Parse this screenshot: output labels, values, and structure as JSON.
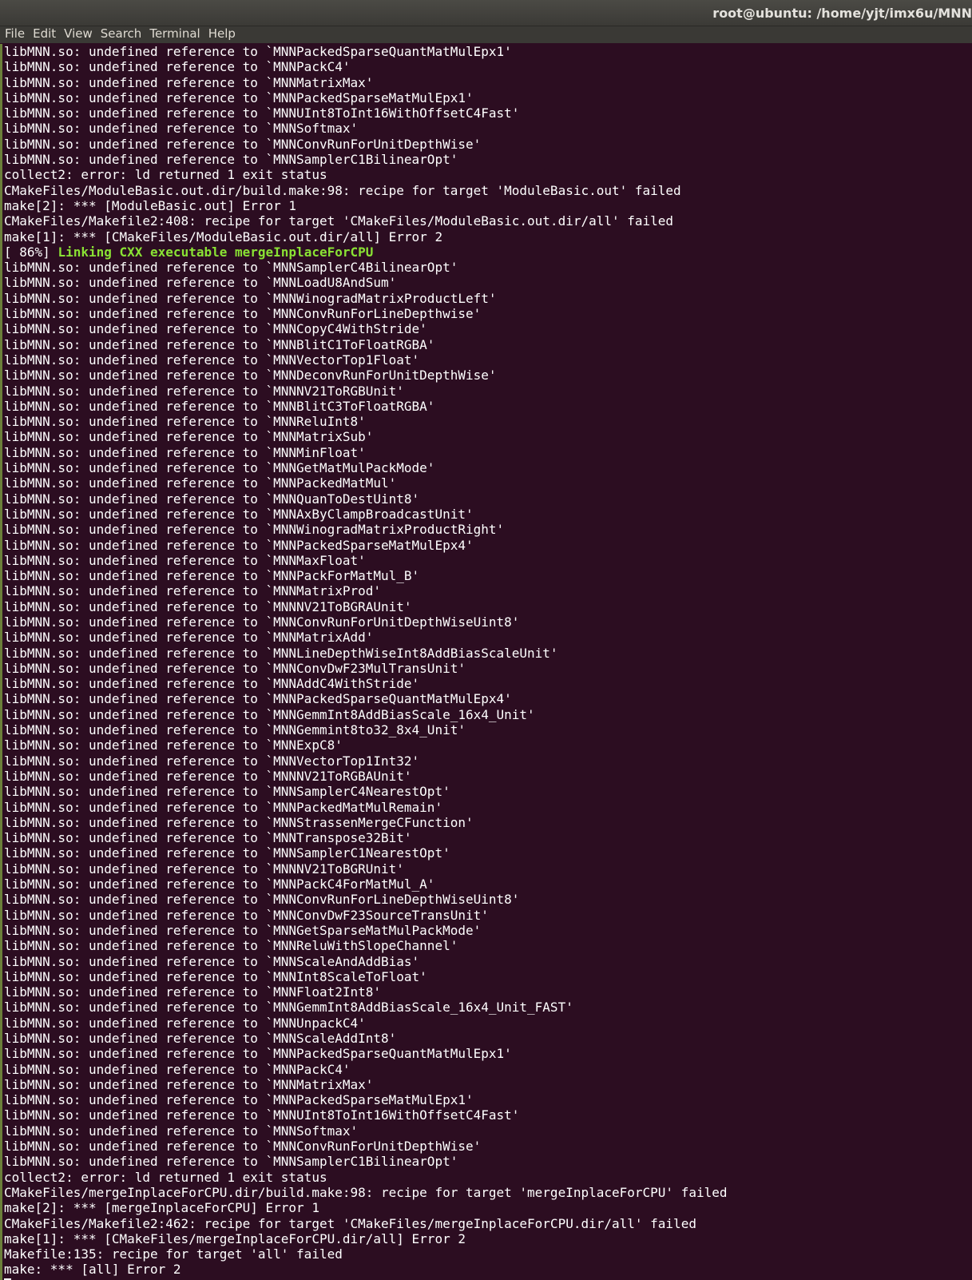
{
  "window": {
    "title": "root@ubuntu: /home/yjt/imx6u/MNN",
    "menu": [
      "File",
      "Edit",
      "View",
      "Search",
      "Terminal",
      "Help"
    ]
  },
  "terminal": {
    "lines": [
      {
        "text": "libMNN.so: undefined reference to `MNNPackedSparseQuantMatMulEpx1'"
      },
      {
        "text": "libMNN.so: undefined reference to `MNNPackC4'"
      },
      {
        "text": "libMNN.so: undefined reference to `MNNMatrixMax'"
      },
      {
        "text": "libMNN.so: undefined reference to `MNNPackedSparseMatMulEpx1'"
      },
      {
        "text": "libMNN.so: undefined reference to `MNNUInt8ToInt16WithOffsetC4Fast'"
      },
      {
        "text": "libMNN.so: undefined reference to `MNNSoftmax'"
      },
      {
        "text": "libMNN.so: undefined reference to `MNNConvRunForUnitDepthWise'"
      },
      {
        "text": "libMNN.so: undefined reference to `MNNSamplerC1BilinearOpt'"
      },
      {
        "text": "collect2: error: ld returned 1 exit status"
      },
      {
        "text": "CMakeFiles/ModuleBasic.out.dir/build.make:98: recipe for target 'ModuleBasic.out' failed"
      },
      {
        "text": "make[2]: *** [ModuleBasic.out] Error 1"
      },
      {
        "text": "CMakeFiles/Makefile2:408: recipe for target 'CMakeFiles/ModuleBasic.out.dir/all' failed"
      },
      {
        "text": "make[1]: *** [CMakeFiles/ModuleBasic.out.dir/all] Error 2"
      },
      {
        "text": "[ 86%] ",
        "green": "Linking CXX executable mergeInplaceForCPU"
      },
      {
        "text": "libMNN.so: undefined reference to `MNNSamplerC4BilinearOpt'"
      },
      {
        "text": "libMNN.so: undefined reference to `MNNLoadU8AndSum'"
      },
      {
        "text": "libMNN.so: undefined reference to `MNNWinogradMatrixProductLeft'"
      },
      {
        "text": "libMNN.so: undefined reference to `MNNConvRunForLineDepthwise'"
      },
      {
        "text": "libMNN.so: undefined reference to `MNNCopyC4WithStride'"
      },
      {
        "text": "libMNN.so: undefined reference to `MNNBlitC1ToFloatRGBA'"
      },
      {
        "text": "libMNN.so: undefined reference to `MNNVectorTop1Float'"
      },
      {
        "text": "libMNN.so: undefined reference to `MNNDeconvRunForUnitDepthWise'"
      },
      {
        "text": "libMNN.so: undefined reference to `MNNNV21ToRGBUnit'"
      },
      {
        "text": "libMNN.so: undefined reference to `MNNBlitC3ToFloatRGBA'"
      },
      {
        "text": "libMNN.so: undefined reference to `MNNReluInt8'"
      },
      {
        "text": "libMNN.so: undefined reference to `MNNMatrixSub'"
      },
      {
        "text": "libMNN.so: undefined reference to `MNNMinFloat'"
      },
      {
        "text": "libMNN.so: undefined reference to `MNNGetMatMulPackMode'"
      },
      {
        "text": "libMNN.so: undefined reference to `MNNPackedMatMul'"
      },
      {
        "text": "libMNN.so: undefined reference to `MNNQuanToDestUint8'"
      },
      {
        "text": "libMNN.so: undefined reference to `MNNAxByClampBroadcastUnit'"
      },
      {
        "text": "libMNN.so: undefined reference to `MNNWinogradMatrixProductRight'"
      },
      {
        "text": "libMNN.so: undefined reference to `MNNPackedSparseMatMulEpx4'"
      },
      {
        "text": "libMNN.so: undefined reference to `MNNMaxFloat'"
      },
      {
        "text": "libMNN.so: undefined reference to `MNNPackForMatMul_B'"
      },
      {
        "text": "libMNN.so: undefined reference to `MNNMatrixProd'"
      },
      {
        "text": "libMNN.so: undefined reference to `MNNNV21ToBGRAUnit'"
      },
      {
        "text": "libMNN.so: undefined reference to `MNNConvRunForUnitDepthWiseUint8'"
      },
      {
        "text": "libMNN.so: undefined reference to `MNNMatrixAdd'"
      },
      {
        "text": "libMNN.so: undefined reference to `MNNLineDepthWiseInt8AddBiasScaleUnit'"
      },
      {
        "text": "libMNN.so: undefined reference to `MNNConvDwF23MulTransUnit'"
      },
      {
        "text": "libMNN.so: undefined reference to `MNNAddC4WithStride'"
      },
      {
        "text": "libMNN.so: undefined reference to `MNNPackedSparseQuantMatMulEpx4'"
      },
      {
        "text": "libMNN.so: undefined reference to `MNNGemmInt8AddBiasScale_16x4_Unit'"
      },
      {
        "text": "libMNN.so: undefined reference to `MNNGemmint8to32_8x4_Unit'"
      },
      {
        "text": "libMNN.so: undefined reference to `MNNExpC8'"
      },
      {
        "text": "libMNN.so: undefined reference to `MNNVectorTop1Int32'"
      },
      {
        "text": "libMNN.so: undefined reference to `MNNNV21ToRGBAUnit'"
      },
      {
        "text": "libMNN.so: undefined reference to `MNNSamplerC4NearestOpt'"
      },
      {
        "text": "libMNN.so: undefined reference to `MNNPackedMatMulRemain'"
      },
      {
        "text": "libMNN.so: undefined reference to `MNNStrassenMergeCFunction'"
      },
      {
        "text": "libMNN.so: undefined reference to `MNNTranspose32Bit'"
      },
      {
        "text": "libMNN.so: undefined reference to `MNNSamplerC1NearestOpt'"
      },
      {
        "text": "libMNN.so: undefined reference to `MNNNV21ToBGRUnit'"
      },
      {
        "text": "libMNN.so: undefined reference to `MNNPackC4ForMatMul_A'"
      },
      {
        "text": "libMNN.so: undefined reference to `MNNConvRunForLineDepthWiseUint8'"
      },
      {
        "text": "libMNN.so: undefined reference to `MNNConvDwF23SourceTransUnit'"
      },
      {
        "text": "libMNN.so: undefined reference to `MNNGetSparseMatMulPackMode'"
      },
      {
        "text": "libMNN.so: undefined reference to `MNNReluWithSlopeChannel'"
      },
      {
        "text": "libMNN.so: undefined reference to `MNNScaleAndAddBias'"
      },
      {
        "text": "libMNN.so: undefined reference to `MNNInt8ScaleToFloat'"
      },
      {
        "text": "libMNN.so: undefined reference to `MNNFloat2Int8'"
      },
      {
        "text": "libMNN.so: undefined reference to `MNNGemmInt8AddBiasScale_16x4_Unit_FAST'"
      },
      {
        "text": "libMNN.so: undefined reference to `MNNUnpackC4'"
      },
      {
        "text": "libMNN.so: undefined reference to `MNNScaleAddInt8'"
      },
      {
        "text": "libMNN.so: undefined reference to `MNNPackedSparseQuantMatMulEpx1'"
      },
      {
        "text": "libMNN.so: undefined reference to `MNNPackC4'"
      },
      {
        "text": "libMNN.so: undefined reference to `MNNMatrixMax'"
      },
      {
        "text": "libMNN.so: undefined reference to `MNNPackedSparseMatMulEpx1'"
      },
      {
        "text": "libMNN.so: undefined reference to `MNNUInt8ToInt16WithOffsetC4Fast'"
      },
      {
        "text": "libMNN.so: undefined reference to `MNNSoftmax'"
      },
      {
        "text": "libMNN.so: undefined reference to `MNNConvRunForUnitDepthWise'"
      },
      {
        "text": "libMNN.so: undefined reference to `MNNSamplerC1BilinearOpt'"
      },
      {
        "text": "collect2: error: ld returned 1 exit status"
      },
      {
        "text": "CMakeFiles/mergeInplaceForCPU.dir/build.make:98: recipe for target 'mergeInplaceForCPU' failed"
      },
      {
        "text": "make[2]: *** [mergeInplaceForCPU] Error 1"
      },
      {
        "text": "CMakeFiles/Makefile2:462: recipe for target 'CMakeFiles/mergeInplaceForCPU.dir/all' failed"
      },
      {
        "text": "make[1]: *** [CMakeFiles/mergeInplaceForCPU.dir/all] Error 2"
      },
      {
        "text": "Makefile:135: recipe for target 'all' failed"
      },
      {
        "text": "make: *** [all] Error 2"
      }
    ]
  },
  "colors": {
    "background": "#2c0d21",
    "text": "#ffffff",
    "highlight": "#8ae234"
  }
}
